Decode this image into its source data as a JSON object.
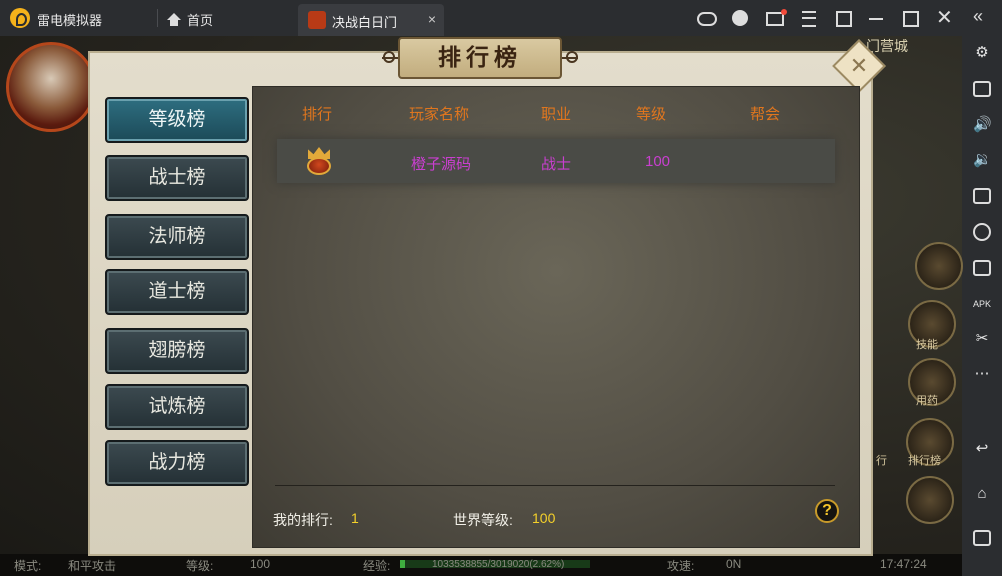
{
  "titlebar": {
    "app_name": "雷电模拟器",
    "home_label": "首页",
    "tab_label": "决战白日门",
    "tab_close": "×"
  },
  "game": {
    "map_label": "门营城",
    "skill_labels": [
      "技能",
      "用药",
      "排行榜",
      "行"
    ],
    "status": {
      "mode_label": "模式:",
      "mode_value": "和平攻击",
      "level_label": "等级:",
      "level_value": "100",
      "exp_label": "经验:",
      "exp_value": "1033538855/3019020(2.62%)",
      "exp_fraction": 0.026,
      "attack_label": "攻速:",
      "attack_value": "0N",
      "time": "17:47:24"
    }
  },
  "dialog": {
    "title": "排行榜",
    "close_glyph": "✕",
    "tabs": [
      {
        "label": "等级榜",
        "active": true
      },
      {
        "label": "战士榜",
        "active": false
      },
      {
        "label": "法师榜",
        "active": false
      },
      {
        "label": "道士榜",
        "active": false
      },
      {
        "label": "翅膀榜",
        "active": false
      },
      {
        "label": "试炼榜",
        "active": false
      },
      {
        "label": "战力榜",
        "active": false
      }
    ],
    "headers": {
      "rank": "排行",
      "name": "玩家名称",
      "job": "职业",
      "level": "等级",
      "guild": "帮会"
    },
    "rows": [
      {
        "rank_icon": "crown-icon",
        "name": "橙子源码",
        "job": "战士",
        "level": "100",
        "guild": ""
      }
    ],
    "footer": {
      "my_rank_label": "我的排行:",
      "my_rank_value": "1",
      "world_level_label": "世界等级:",
      "world_level_value": "100",
      "help_glyph": "?"
    }
  },
  "colors": {
    "header_text": "#e0761e",
    "row_text": "#c93fd0",
    "footer_value": "#f5d12a",
    "active_tab": "#2e6e80"
  }
}
